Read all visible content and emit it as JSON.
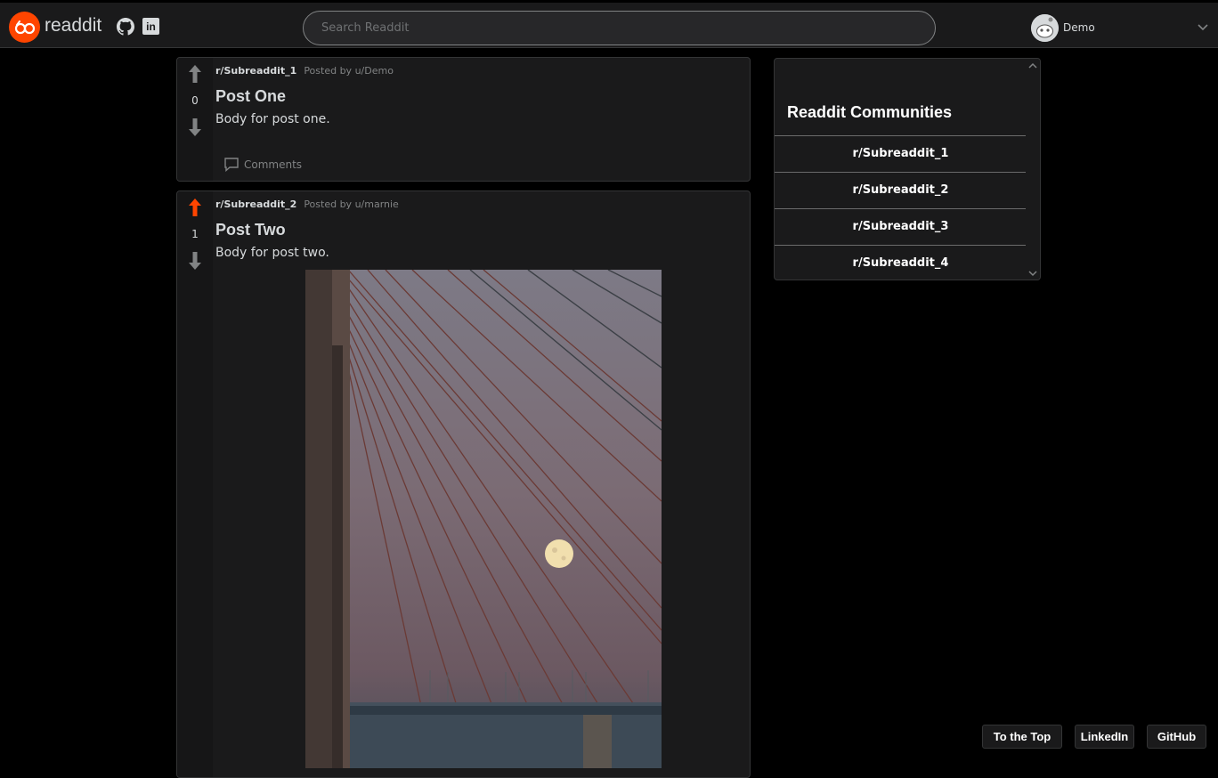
{
  "header": {
    "brand": "readdit",
    "search_placeholder": "Search Readdit",
    "username": "Demo"
  },
  "posts": [
    {
      "subreddit": "r/Subreaddit_1",
      "posted_by": "Posted by u/Demo",
      "title": "Post One",
      "body": "Body for post one.",
      "votes": "0",
      "vote_state": "none",
      "comments_label": "Comments"
    },
    {
      "subreddit": "r/Subreaddit_2",
      "posted_by": "Posted by u/marnie",
      "title": "Post Two",
      "body": "Body for post two.",
      "votes": "1",
      "vote_state": "up"
    }
  ],
  "sidebar": {
    "title": "Readdit Communities",
    "items": [
      "r/Subreaddit_1",
      "r/Subreaddit_2",
      "r/Subreaddit_3",
      "r/Subreaddit_4"
    ]
  },
  "footer": {
    "top_label": "To the Top",
    "linkedin_label": "LinkedIn",
    "github_label": "GitHub"
  },
  "colors": {
    "accent": "#ff4500",
    "background": "#000000",
    "card": "#1a1a1b"
  }
}
